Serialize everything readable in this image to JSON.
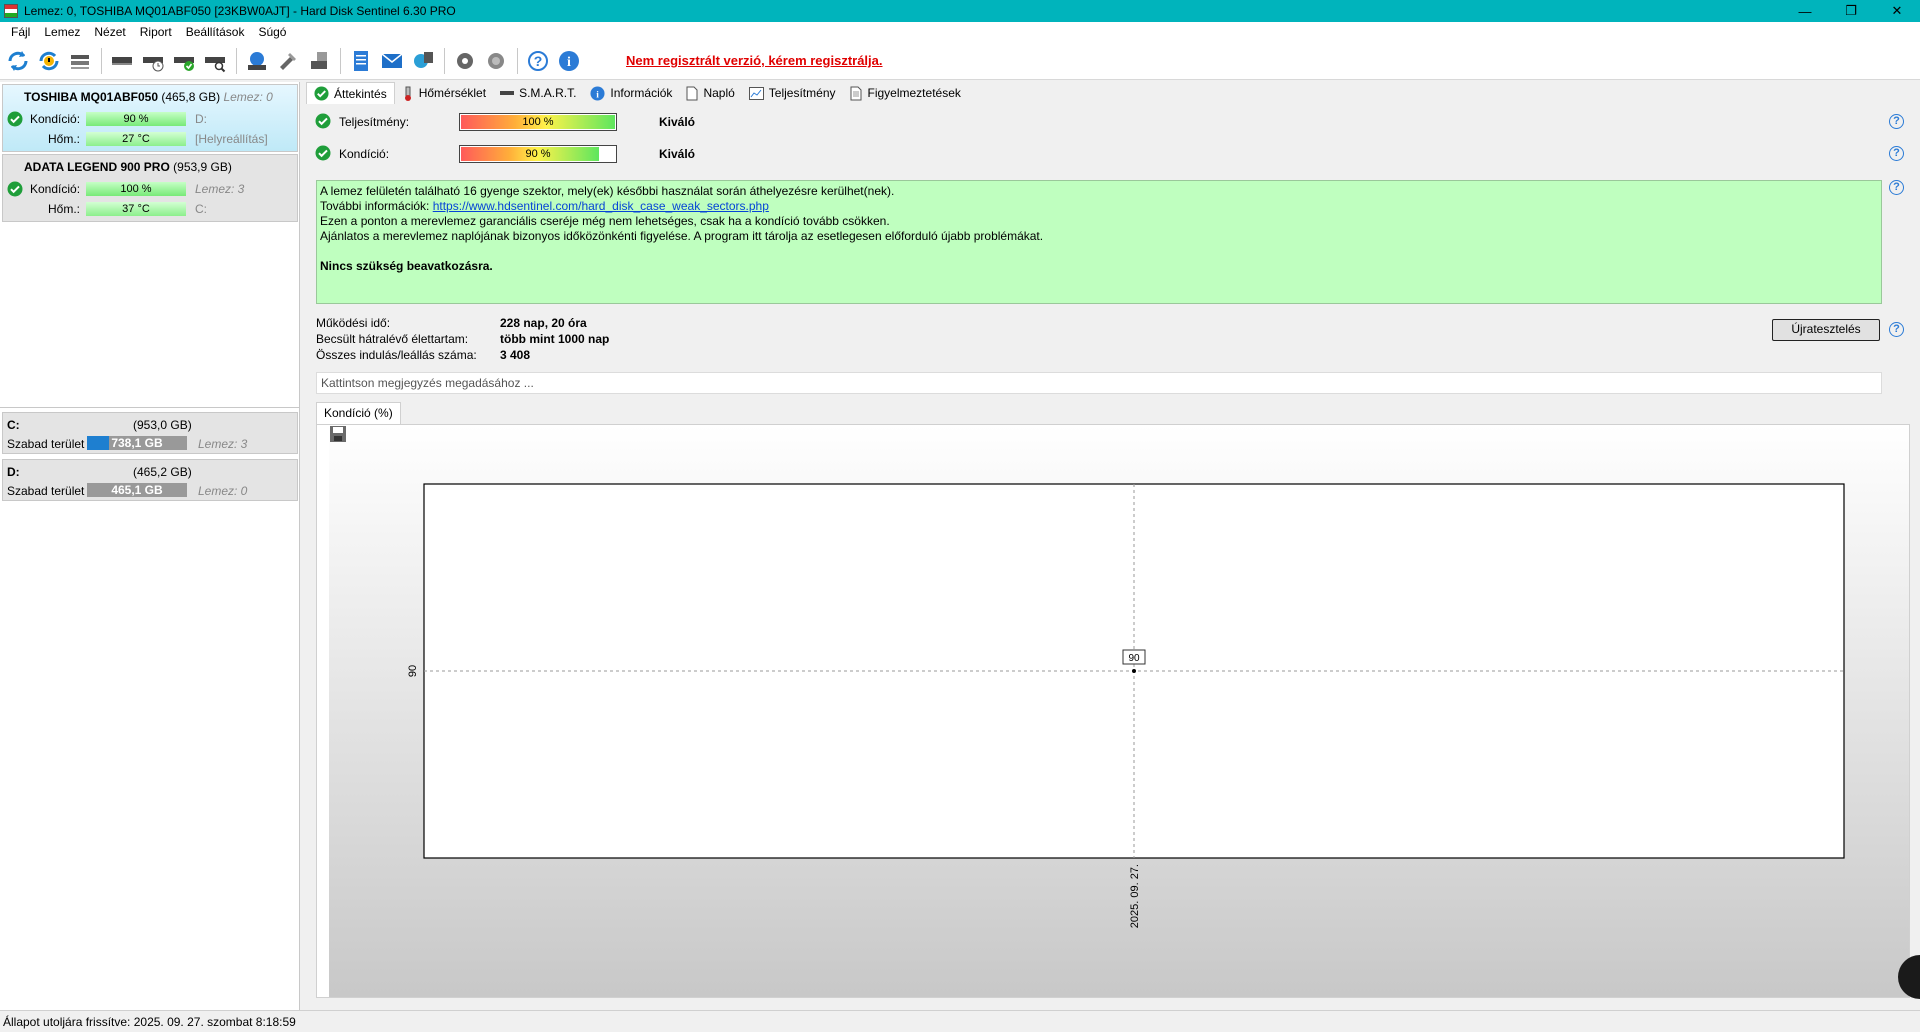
{
  "window": {
    "title": "Lemez: 0, TOSHIBA MQ01ABF050 [23KBW0AJT]  -  Hard Disk Sentinel 6.30 PRO"
  },
  "menu": [
    "Fájl",
    "Lemez",
    "Nézet",
    "Riport",
    "Beállítások",
    "Súgó"
  ],
  "toolbar": {
    "unregistered_text": "Nem regisztrált verzió, kérem regisztrálja."
  },
  "disks": [
    {
      "name": "TOSHIBA MQ01ABF050",
      "size": "(465,8 GB)",
      "index": "Lemez: 0",
      "health_label": "Kondíció:",
      "health_value": "90 %",
      "temp_label": "Hőm.:",
      "temp_value": "27 °C",
      "volume": "D:",
      "extra": "[Helyreállítás]"
    },
    {
      "name": "ADATA LEGEND 900 PRO",
      "size": "(953,9 GB)",
      "health_label": "Kondíció:",
      "health_value": "100 %",
      "index": "Lemez: 3",
      "temp_label": "Hőm.:",
      "temp_value": "37 °C",
      "volume": "C:"
    }
  ],
  "volumes": [
    {
      "letter": "C:",
      "size": "(953,0 GB)",
      "free_label": "Szabad terület",
      "free_value": "738,1 GB",
      "disk": "Lemez: 3"
    },
    {
      "letter": "D:",
      "size": "(465,2 GB)",
      "free_label": "Szabad terület",
      "free_value": "465,1 GB",
      "disk": "Lemez: 0"
    }
  ],
  "tabs": [
    "Áttekintés",
    "Hőmérséklet",
    "S.M.A.R.T.",
    "Információk",
    "Napló",
    "Teljesítmény",
    "Figyelmeztetések"
  ],
  "overview": {
    "performance": {
      "label": "Teljesítmény:",
      "value": "100 %",
      "fraction": 1.0,
      "verdict": "Kiváló"
    },
    "health": {
      "label": "Kondíció:",
      "value": "90 %",
      "fraction": 0.9,
      "verdict": "Kiváló"
    },
    "info_lines": [
      "A lemez felületén található 16 gyenge szektor, mely(ek) későbbi használat során áthelyezésre kerülhet(nek).",
      "További információk: ",
      "Ezen a ponton a merevlemez garanciális cseréje még nem lehetséges, csak ha a kondíció tovább csökken.",
      "Ajánlatos a merevlemez naplójának bizonyos időközönkénti figyelése. A program itt tárolja az esetlegesen előforduló újabb problémákat."
    ],
    "info_link": "https://www.hdsentinel.com/hard_disk_case_weak_sectors.php",
    "info_conclusion": "Nincs szükség beavatkozásra.",
    "stats": [
      {
        "label": "Működési idő:",
        "value": "228 nap, 20 óra"
      },
      {
        "label": "Becsült hátralévő élettartam:",
        "value": "több mint 1000 nap"
      },
      {
        "label": "Összes indulás/leállás száma:",
        "value": "3 408"
      }
    ],
    "retest_button": "Újratesztelés",
    "note_placeholder": "Kattintson megjegyzés megadásához ...",
    "graph_tab": "Kondíció  (%)"
  },
  "chart_data": {
    "type": "line",
    "x": [
      "2025. 09. 27."
    ],
    "series": [
      {
        "values": [
          90
        ]
      }
    ],
    "y_tick": "90",
    "x_tick": "2025. 09. 27.",
    "point_label": "90"
  },
  "statusbar": {
    "text": "Állapot utoljára frissítve: 2025. 09. 27. szombat 8:18:59"
  }
}
